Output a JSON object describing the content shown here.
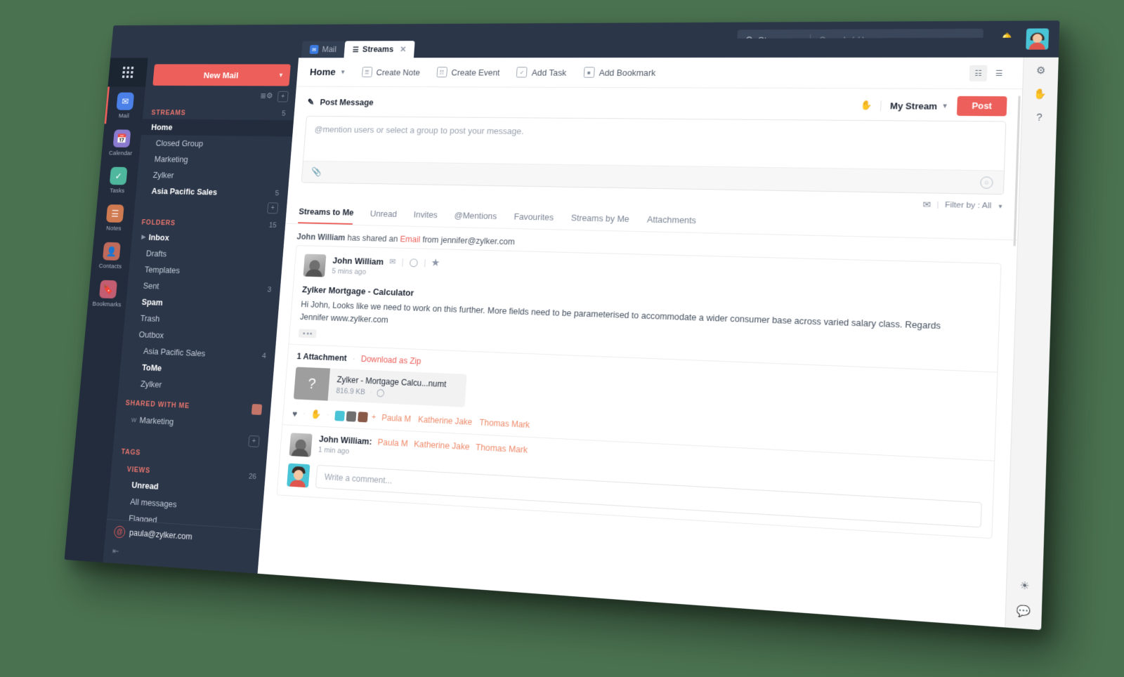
{
  "colors": {
    "accent": "#ec5f5a",
    "nav_bg": "#2b3648",
    "rail_bg": "#222c3c",
    "page_bg": "#4a7250",
    "mention": "#ef8a6a"
  },
  "topbar": {
    "search_scope": "Streams",
    "search_placeholder": "Search ( / )",
    "bell_icon": "bell-icon",
    "avatar_icon": "user-avatar"
  },
  "rail": {
    "grid_icon": "app-grid-icon",
    "items": [
      {
        "label": "Mail",
        "icon": "mail-icon",
        "color": "#4a80e8",
        "active": true
      },
      {
        "label": "Calendar",
        "icon": "calendar-icon",
        "color": "#8b7bd0",
        "active": false
      },
      {
        "label": "Tasks",
        "icon": "tasks-check-icon",
        "color": "#4fb79e",
        "active": false
      },
      {
        "label": "Notes",
        "icon": "notes-icon",
        "color": "#cf7a50",
        "active": false
      },
      {
        "label": "Contacts",
        "icon": "contacts-icon",
        "color": "#c06a5c",
        "active": false
      },
      {
        "label": "Bookmarks",
        "icon": "bookmark-icon",
        "color": "#c25d72",
        "active": false
      }
    ]
  },
  "sidebar": {
    "new_mail": "New Mail",
    "sections": [
      {
        "title": "STREAMS",
        "count": "5",
        "items": [
          {
            "label": "Home",
            "count": "",
            "bold": true,
            "selected": true,
            "indent": 0
          },
          {
            "label": "Closed Group",
            "count": "",
            "bold": false,
            "selected": false,
            "indent": 1
          },
          {
            "label": "Marketing",
            "count": "",
            "bold": false,
            "selected": false,
            "indent": 1
          },
          {
            "label": "Zylker",
            "count": "",
            "bold": false,
            "selected": false,
            "indent": 1
          },
          {
            "label": "Asia Pacific Sales",
            "count": "5",
            "bold": true,
            "selected": false,
            "indent": 1
          }
        ]
      },
      {
        "title": "FOLDERS",
        "count": "15",
        "items": [
          {
            "label": "Inbox",
            "count": "",
            "bold": true,
            "selected": false,
            "indent": 0,
            "chevron": true
          },
          {
            "label": "Drafts",
            "count": "",
            "bold": false,
            "selected": false,
            "indent": 1
          },
          {
            "label": "Templates",
            "count": "",
            "bold": false,
            "selected": false,
            "indent": 1
          },
          {
            "label": "Sent",
            "count": "3",
            "bold": false,
            "selected": false,
            "indent": 1
          },
          {
            "label": "Spam",
            "count": "",
            "bold": true,
            "selected": false,
            "indent": 1
          },
          {
            "label": "Trash",
            "count": "",
            "bold": false,
            "selected": false,
            "indent": 1
          },
          {
            "label": "Outbox",
            "count": "",
            "bold": false,
            "selected": false,
            "indent": 1
          },
          {
            "label": "Asia Pacific Sales",
            "count": "4",
            "bold": false,
            "selected": false,
            "indent": 2
          },
          {
            "label": "ToMe",
            "count": "",
            "bold": true,
            "selected": false,
            "indent": 2
          },
          {
            "label": "Zylker",
            "count": "",
            "bold": false,
            "selected": false,
            "indent": 2
          }
        ]
      },
      {
        "title": "SHARED WITH ME",
        "count": "",
        "items": [
          {
            "label": "Marketing",
            "count": "",
            "bold": false,
            "selected": false,
            "indent": 1,
            "prefix": "W"
          }
        ]
      },
      {
        "title": "TAGS",
        "count": "",
        "items": []
      },
      {
        "title": "VIEWS",
        "count": "26",
        "items": [
          {
            "label": "Unread",
            "count": "",
            "bold": true,
            "selected": false,
            "indent": 1
          },
          {
            "label": "All messages",
            "count": "",
            "bold": false,
            "selected": false,
            "indent": 1
          },
          {
            "label": "Flagged",
            "count": "",
            "bold": false,
            "selected": false,
            "indent": 1
          }
        ]
      }
    ],
    "account_email": "paula@zylker.com",
    "collapse_icon": "collapse-sidebar-icon"
  },
  "tabs": [
    {
      "label": "Mail",
      "active": false,
      "icon": "mail-tab-icon"
    },
    {
      "label": "Streams",
      "active": true,
      "icon": "streams-tab-icon",
      "closable": true
    }
  ],
  "pane": {
    "title": "Home",
    "actions": [
      {
        "label": "Create Note",
        "icon": "note-icon"
      },
      {
        "label": "Create Event",
        "icon": "calendar-event-icon"
      },
      {
        "label": "Add Task",
        "icon": "task-check-icon"
      },
      {
        "label": "Add Bookmark",
        "icon": "bookmark-add-icon"
      }
    ],
    "view_toggles": [
      {
        "icon": "card-view-icon",
        "active": true
      },
      {
        "icon": "list-view-icon",
        "active": false
      }
    ]
  },
  "composer": {
    "tabs": [
      {
        "label": "Post Message",
        "active": true,
        "icon": "compose-icon"
      },
      {
        "label": "Create Note",
        "active": false,
        "icon": "note-icon"
      },
      {
        "label": "Create Event",
        "active": false,
        "icon": "calendar-event-icon"
      },
      {
        "label": "Add Task",
        "active": false,
        "icon": "task-check-icon"
      },
      {
        "label": "Add Bookmark",
        "active": false,
        "icon": "bookmark-add-icon"
      }
    ],
    "placeholder": "@mention users or select a group to post your message.",
    "value": "",
    "stream_selector": "My Stream",
    "post_label": "Post",
    "attach_icon": "paperclip-icon",
    "emoji_icon": "smiley-icon"
  },
  "filter": {
    "label": "Filter by : All",
    "icon": "filter-envelope-icon"
  },
  "stream_tabs": [
    {
      "label": "Streams to Me",
      "active": true
    },
    {
      "label": "Unread",
      "active": false
    },
    {
      "label": "Invites",
      "active": false
    },
    {
      "label": "@Mentions",
      "active": false
    },
    {
      "label": "Favourites",
      "active": false
    },
    {
      "label": "Streams by Me",
      "active": false
    },
    {
      "label": "Attachments",
      "active": false
    }
  ],
  "post": {
    "share_prefix": "John William",
    "share_mid": "has shared an",
    "share_link": "Email",
    "share_suffix": "from jennifer@zylker.com",
    "author": "John William",
    "time": "5 mins ago",
    "subject": "Zylker Mortgage - Calculator",
    "body_line1": "Hi John, Looks like we need to work on this further. More fields need to be parameterised to accommodate a wider consumer base across varied salary class. Regards",
    "body_line2": "Jennifer www.zylker.com",
    "more_icon": "more-dots-icon",
    "envelope_icon": "envelope-icon",
    "tag_icon": "tag-icon",
    "star_icon": "star-icon",
    "attachments_label": "1 Attachment",
    "download_zip": "Download as Zip",
    "attachment": {
      "name": "Zylker - Mortgage Calcu...numt",
      "size": "816.9 KB",
      "thumb_glyph": "?",
      "tag_icon": "tag-icon"
    },
    "reactions": {
      "heart_icon": "heart-icon",
      "like_icon": "like-hand-icon",
      "plus": "+",
      "names": [
        "Paula M",
        "Katherine Jake",
        "Thomas Mark"
      ]
    },
    "comment": {
      "author": "John William:",
      "mentions": [
        "Paula M",
        "Katherine Jake",
        "Thomas Mark"
      ],
      "time": "1 min ago"
    },
    "comment_placeholder": "Write a comment..."
  },
  "right_rail": {
    "icons": [
      {
        "name": "gear-icon",
        "glyph": "⚙"
      },
      {
        "name": "paperclip-icon",
        "glyph": "✋"
      },
      {
        "name": "help-icon",
        "glyph": "?"
      }
    ],
    "bottom_icons": [
      {
        "name": "brightness-icon",
        "glyph": "☀"
      },
      {
        "name": "chat-icon",
        "glyph": "💬"
      }
    ]
  }
}
